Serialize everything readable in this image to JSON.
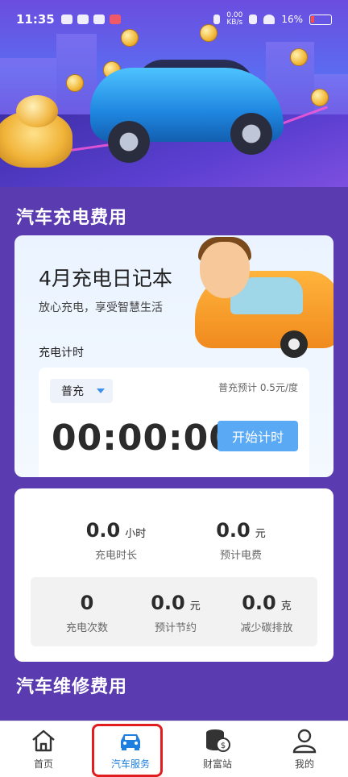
{
  "status_bar": {
    "time": "11:35",
    "net_speed_value": "0.00",
    "net_speed_unit": "KB/s",
    "battery": "16%"
  },
  "sections": {
    "charging_cost_title": "汽车充电费用",
    "repair_cost_title": "汽车维修费用"
  },
  "diary_card": {
    "title": "4月充电日记本",
    "subtitle": "放心充电，享受智慧生活",
    "timer_label": "充电计时",
    "mode_value": "普充",
    "price_note": "普充预计 0.5元/度",
    "timer_value": "00:00:00",
    "start_button": "开始计时"
  },
  "stats_card": {
    "duration": {
      "value": "0.0",
      "unit": "小时",
      "label": "充电时长"
    },
    "fee": {
      "value": "0.0",
      "unit": "元",
      "label": "预计电费"
    },
    "count": {
      "value": "0",
      "label": "充电次数"
    },
    "savings": {
      "value": "0.0",
      "unit": "元",
      "label": "预计节约"
    },
    "carbon": {
      "value": "0.0",
      "unit": "克",
      "label": "减少碳排放"
    }
  },
  "bottom_nav": {
    "items": [
      {
        "label": "首页",
        "icon": "home-icon"
      },
      {
        "label": "汽车服务",
        "icon": "car-icon",
        "active": true
      },
      {
        "label": "财富站",
        "icon": "coin-stack-icon"
      },
      {
        "label": "我的",
        "icon": "user-icon"
      }
    ]
  },
  "colors": {
    "background": "#5a3cb0",
    "accent": "#1e7fe0",
    "button": "#5aa9f4",
    "highlight": "#e11d1d"
  }
}
